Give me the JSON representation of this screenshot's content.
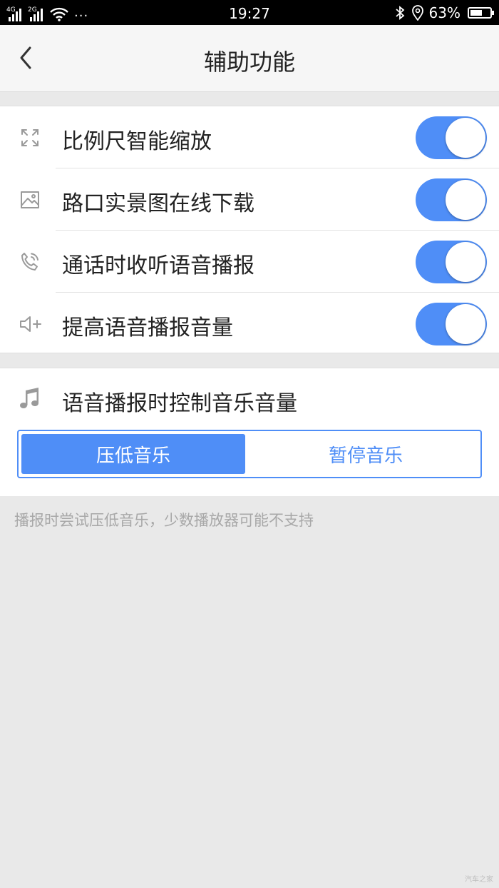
{
  "status_bar": {
    "network_1": "4G",
    "network_2": "2G",
    "more": "···",
    "time": "19:27",
    "battery_percent": "63%",
    "battery_level": 0.63
  },
  "header": {
    "title": "辅助功能",
    "back_icon": "chevron-left-icon"
  },
  "settings": [
    {
      "label": "比例尺智能缩放",
      "icon": "expand-icon",
      "enabled": true
    },
    {
      "label": "路口实景图在线下载",
      "icon": "image-icon",
      "enabled": true
    },
    {
      "label": "通话时收听语音播报",
      "icon": "phone-call-icon",
      "enabled": true
    },
    {
      "label": "提高语音播报音量",
      "icon": "volume-up-icon",
      "enabled": true
    }
  ],
  "music_control": {
    "label": "语音播报时控制音乐音量",
    "icon": "music-note-icon",
    "options": [
      "压低音乐",
      "暂停音乐"
    ],
    "selected": "压低音乐"
  },
  "hint": "播报时尝试压低音乐，少数播放器可能不支持",
  "watermark": "汽车之家",
  "colors": {
    "accent": "#4f8ef7",
    "page_background": "#e9e9e9",
    "status_bar": "#000000"
  }
}
